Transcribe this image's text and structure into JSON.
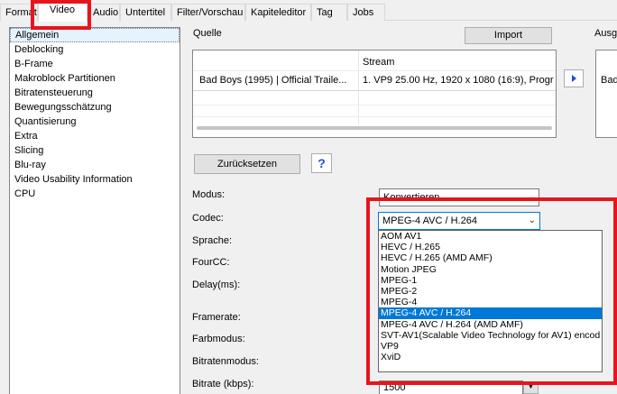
{
  "tabs": [
    {
      "label": "Format",
      "active": false
    },
    {
      "label": "Video",
      "active": true
    },
    {
      "label": "Audio",
      "active": false
    },
    {
      "label": "Untertitel",
      "active": false
    },
    {
      "label": "Filter/Vorschau",
      "active": false
    },
    {
      "label": "Kapiteleditor",
      "active": false
    },
    {
      "label": "Tag",
      "active": false
    },
    {
      "label": "Jobs",
      "active": false
    }
  ],
  "sidebar": {
    "items": [
      "Allgemein",
      "Deblocking",
      "B-Frame",
      "Makroblock Partitionen",
      "Bitratensteuerung",
      "Bewegungsschätzung",
      "Quantisierung",
      "Extra",
      "Slicing",
      "Blu-ray",
      "Video Usability Information",
      "CPU"
    ],
    "selected_index": 0
  },
  "source": {
    "label": "Quelle",
    "import_label": "Import",
    "stream_header": "Stream",
    "file_cell": "Bad Boys (1995)  |  Official Traile...",
    "stream_cell": "1. VP9 25.00 Hz, 1920 x 1080 (16:9), Progr"
  },
  "output": {
    "label": "Ausga",
    "cell": "Bad"
  },
  "reset_label": "Zurücksetzen",
  "help_label": "?",
  "form": {
    "modus_label": "Modus:",
    "modus_value": "Konvertieren",
    "codec_label": "Codec:",
    "codec_value": "MPEG-4 AVC / H.264",
    "sprache_label": "Sprache:",
    "fourcc_label": "FourCC:",
    "delay_label": "Delay(ms):",
    "framerate_label": "Framerate:",
    "farbmodus_label": "Farbmodus:",
    "bitratenmodus_label": "Bitratenmodus:",
    "bitrate_label": "Bitrate (kbps):",
    "bitrate_value": "1500"
  },
  "codec_options": [
    "AOM AV1",
    "HEVC / H.265",
    "HEVC / H.265 (AMD AMF)",
    "Motion JPEG",
    "MPEG-1",
    "MPEG-2",
    "MPEG-4",
    "MPEG-4 AVC / H.264",
    "MPEG-4 AVC / H.264 (AMD AMF)",
    "SVT-AV1(Scalable Video Technology for AV1) encod",
    "VP9",
    "XviD"
  ],
  "codec_selected_index": 7,
  "colors": {
    "highlight_box": "#e8141c",
    "selection": "#0078d7",
    "accent_icon": "#1a4fd6"
  }
}
